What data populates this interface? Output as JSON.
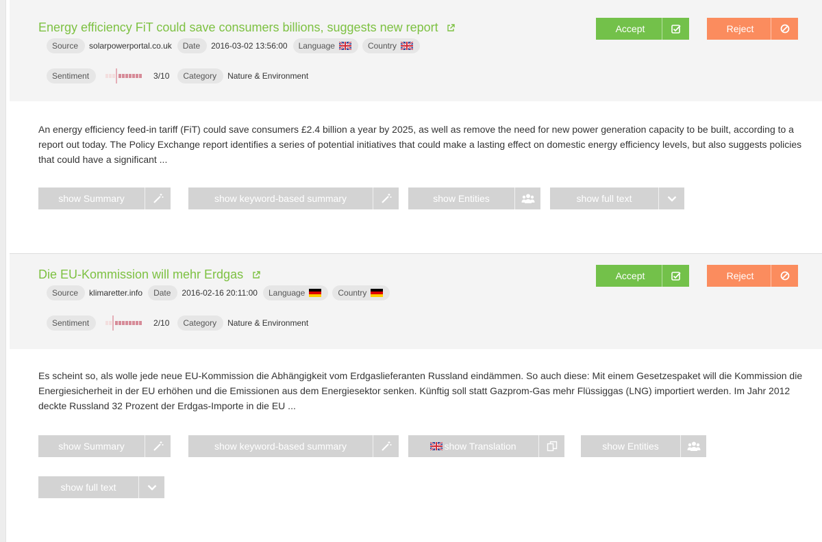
{
  "articles": [
    {
      "title": "Energy efficiency FiT could save consumers billions, suggests new report",
      "source_label": "Source",
      "source": "solarpowerportal.co.uk",
      "date_label": "Date",
      "date": "2016-03-02 13:56:00",
      "language_label": "Language",
      "language_flag": "uk-flag-icon",
      "country_label": "Country",
      "country_flag": "uk-flag-icon",
      "sentiment_label": "Sentiment",
      "sentiment_value": 3,
      "sentiment_text": "3/10",
      "category_label": "Category",
      "category": "Nature & Environment",
      "accept_label": "Accept",
      "reject_label": "Reject",
      "excerpt": "An energy efficiency feed-in tariff (FiT) could save consumers £2.4 billion a year by 2025, as well as remove the need for new power generation capacity to be built, according to a report out today. The Policy Exchange report identifies a series of potential initiatives that could make a lasting effect on domestic energy efficiency levels, but also suggests policies that could have a significant ...",
      "buttons": {
        "summary": "show Summary",
        "keyword_summary": "show keyword-based summary",
        "entities": "show Entities",
        "full_text": "show full text"
      }
    },
    {
      "title": "Die EU-Kommission will mehr Erdgas",
      "source_label": "Source",
      "source": "klimaretter.info",
      "date_label": "Date",
      "date": "2016-02-16 20:11:00",
      "language_label": "Language",
      "language_flag": "germany-flag-icon",
      "country_label": "Country",
      "country_flag": "germany-flag-icon",
      "sentiment_label": "Sentiment",
      "sentiment_value": 2,
      "sentiment_text": "2/10",
      "category_label": "Category",
      "category": "Nature & Environment",
      "accept_label": "Accept",
      "reject_label": "Reject",
      "excerpt": "Es scheint so, als wolle jede neue EU-Kommission die Abhängigkeit vom Erdgaslieferanten Russland eindämmen. So auch diese: Mit einem Gesetzespaket will die Kommission die Energiesicherheit in der EU erhöhen und die Emissionen aus dem Energiesektor senken. Künftig soll statt Gazprom-Gas mehr Flüssiggas (LNG) importiert werden.   Im Jahr 2012 deckte Russland 32 Prozent der Erdgas-Importe in die EU ...",
      "buttons": {
        "summary": "show Summary",
        "keyword_summary": "show keyword-based summary",
        "translation": "show Translation",
        "entities": "show Entities",
        "full_text": "show full text"
      }
    }
  ],
  "colors": {
    "title": "#7dc142",
    "accept": "#73c14a",
    "reject": "#fb8c5e",
    "tool_button": "#d3d3d3",
    "header_bg": "#f4f4f4",
    "pill_bg": "#e6e6e6"
  },
  "icons": {
    "external_link": "external-link-icon",
    "accept": "check-square-icon",
    "reject": "ban-icon",
    "summary": "magic-wand-icon",
    "keyword_summary": "magic-wand-icon",
    "translation": "copy-icon",
    "entities": "users-icon",
    "full_text": "chevron-down-icon"
  }
}
